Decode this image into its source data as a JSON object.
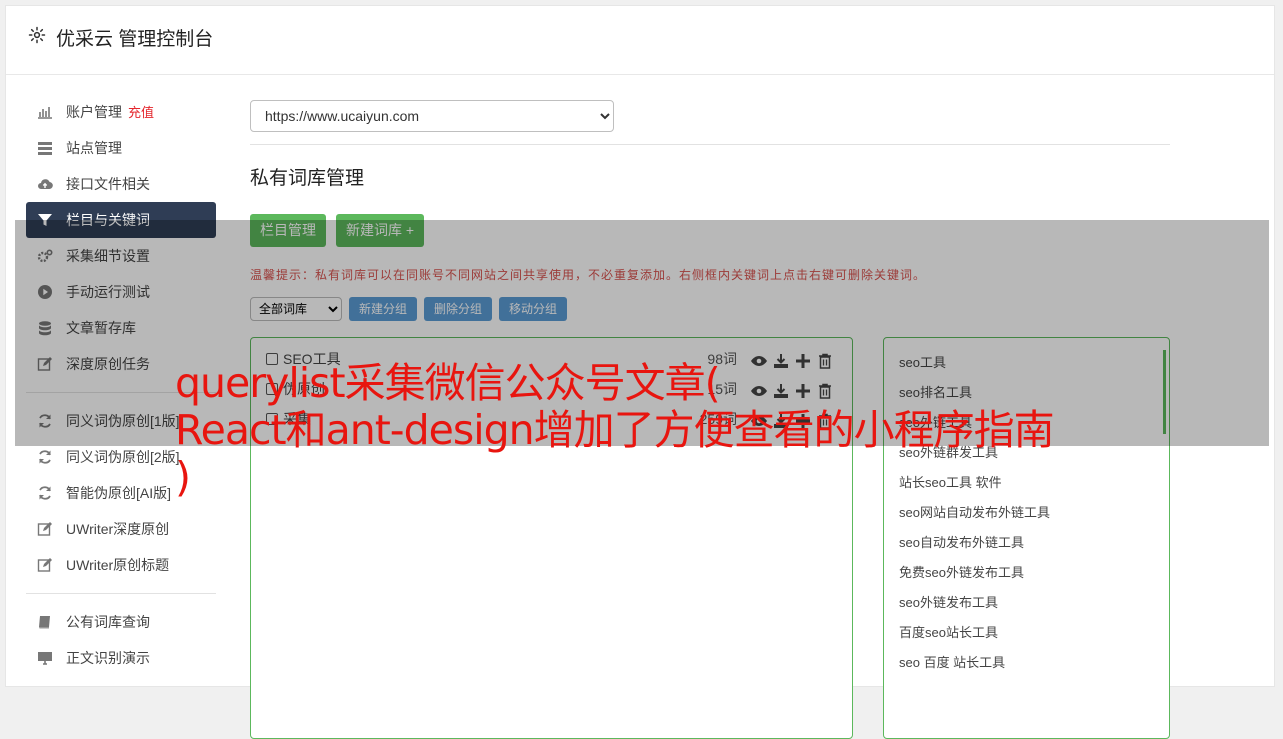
{
  "header": {
    "title": "优采云 管理控制台"
  },
  "sidebar": {
    "items": [
      {
        "label": "账户管理",
        "badge": "充值",
        "icon": "bar-chart-icon"
      },
      {
        "label": "站点管理",
        "icon": "server-icon"
      },
      {
        "label": "接口文件相关",
        "icon": "cloud-upload-icon"
      },
      {
        "label": "栏目与关键词",
        "icon": "filter-icon",
        "active": true
      },
      {
        "label": "采集细节设置",
        "icon": "cogs-icon"
      },
      {
        "label": "手动运行测试",
        "icon": "play-circle-icon"
      },
      {
        "label": "文章暂存库",
        "icon": "database-icon"
      },
      {
        "label": "深度原创任务",
        "icon": "edit-icon"
      }
    ],
    "items2": [
      {
        "label": "同义词伪原创[1版]",
        "icon": "refresh-icon"
      },
      {
        "label": "同义词伪原创[2版]",
        "icon": "refresh-icon"
      },
      {
        "label": "智能伪原创[AI版]",
        "icon": "refresh-icon"
      },
      {
        "label": "UWriter深度原创",
        "icon": "edit-icon"
      },
      {
        "label": "UWriter原创标题",
        "icon": "edit-icon"
      }
    ],
    "items3": [
      {
        "label": "公有词库查询",
        "icon": "book-icon"
      },
      {
        "label": "正文识别演示",
        "icon": "monitor-icon"
      }
    ]
  },
  "main": {
    "site_select": "https://www.ucaiyun.com",
    "title": "私有词库管理",
    "btn_columns": "栏目管理",
    "btn_new_lib": "新建词库 +",
    "tip": "温馨提示：私有词库可以在同账号不同网站之间共享使用，不必重复添加。右侧框内关键词上点击右键可删除关键词。",
    "filter_select": "全部词库",
    "btn_new_group": "新建分组",
    "btn_del_group": "删除分组",
    "btn_move_group": "移动分组",
    "libraries": [
      {
        "name": "SEO工具",
        "count": "98词"
      },
      {
        "name": "伪原创",
        "count": "15词"
      },
      {
        "name": "采集",
        "count": "259词"
      }
    ],
    "keywords": [
      "seo工具",
      "seo排名工具",
      "seo外链工具",
      "seo外链群发工具",
      "站长seo工具 软件",
      "seo网站自动发布外链工具",
      "seo自动发布外链工具",
      "免费seo外链发布工具",
      "seo外链发布工具",
      "百度seo站长工具",
      "seo 百度 站长工具"
    ]
  },
  "overlay": {
    "line1": "querylist采集微信公众号文章(",
    "line2": "React和ant-design增加了方便查看的小程序指南",
    "line3": ")"
  },
  "colors": {
    "accent_green": "#5cb85c",
    "accent_blue": "#5b9bd5",
    "sidebar_active": "#2f3d55",
    "tip_red": "#d9534f",
    "headline_red": "#e8150f"
  }
}
